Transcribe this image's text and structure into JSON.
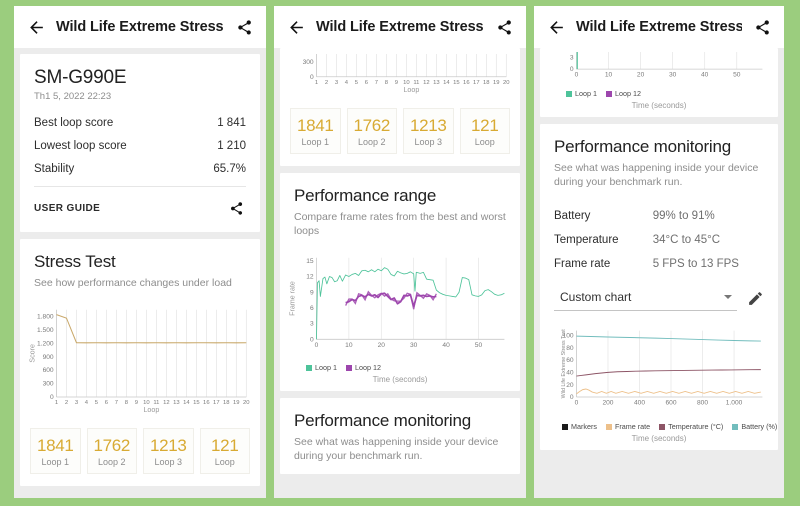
{
  "background_color": "#9bcd7e",
  "app": {
    "title": "Wild Life Extreme Stress...",
    "back_icon": "back-arrow-icon",
    "share_icon": "share-icon"
  },
  "summary": {
    "device": "SM-G990E",
    "timestamp": "Th1 5, 2022 22:23",
    "rows": [
      {
        "label": "Best loop score",
        "value": "1 841"
      },
      {
        "label": "Lowest loop score",
        "value": "1 210"
      },
      {
        "label": "Stability",
        "value": "65.7%"
      }
    ],
    "user_guide_label": "USER GUIDE"
  },
  "stress_test": {
    "title": "Stress Test",
    "subtitle": "See how performance changes under load"
  },
  "performance_range": {
    "title": "Performance range",
    "subtitle": "Compare frame rates from the best and worst loops"
  },
  "performance_monitoring": {
    "title": "Performance monitoring",
    "subtitle": "See what was happening inside your device during your benchmark run.",
    "rows": [
      {
        "label": "Battery",
        "value": "99% to 91%"
      },
      {
        "label": "Temperature",
        "value": "34°C to 45°C"
      },
      {
        "label": "Frame rate",
        "value": "5 FPS to 13 FPS"
      }
    ],
    "chart_select": {
      "value": "Custom chart",
      "edit_icon": "pencil-icon"
    }
  },
  "loop_cards": [
    {
      "score": "1841",
      "label": "Loop 1"
    },
    {
      "score": "1762",
      "label": "Loop 2"
    },
    {
      "score": "1213",
      "label": "Loop 3"
    },
    {
      "score": "121",
      "label": "Loop"
    }
  ],
  "chart_data": [
    {
      "id": "stress-test-chart",
      "type": "line",
      "title": "Stress Test",
      "xlabel": "Loop",
      "ylabel": "Score",
      "line_color": "#c9a86a",
      "grid": true,
      "xlim": [
        1,
        20
      ],
      "ylim": [
        0,
        1950
      ],
      "yticks": [
        0,
        300,
        600,
        900,
        1200,
        1500,
        1800
      ],
      "ytick_labels": [
        "0",
        "300",
        "600",
        "900",
        "1.200",
        "1.500",
        "1.800"
      ],
      "xticks": [
        1,
        2,
        3,
        4,
        5,
        6,
        7,
        8,
        9,
        10,
        11,
        12,
        13,
        14,
        15,
        16,
        17,
        18,
        19,
        20
      ],
      "x": [
        1,
        2,
        3,
        4,
        5,
        6,
        7,
        8,
        9,
        10,
        11,
        12,
        13,
        14,
        15,
        16,
        17,
        18,
        19,
        20
      ],
      "values": [
        1841,
        1762,
        1213,
        1210,
        1211,
        1210,
        1212,
        1210,
        1211,
        1210,
        1212,
        1210,
        1211,
        1210,
        1212,
        1211,
        1210,
        1211,
        1210,
        1212
      ]
    },
    {
      "id": "performance-range-chart",
      "type": "line",
      "title": "Performance range",
      "xlabel": "Time (seconds)",
      "ylabel": "Frame rate",
      "grid": true,
      "xlim": [
        0,
        58
      ],
      "ylim": [
        0,
        15.6
      ],
      "yticks": [
        0,
        3,
        6,
        9,
        12,
        15
      ],
      "xticks": [
        0,
        10,
        20,
        30,
        40,
        50
      ],
      "legend_position": "bottom-left",
      "series": [
        {
          "name": "Loop 1",
          "color": "#4ec39a",
          "x": [
            0,
            0.3,
            0.8,
            1.2,
            2,
            2.6,
            3.2,
            4,
            4.8,
            5.6,
            6.4,
            7.2,
            8,
            9,
            10,
            11,
            12,
            13,
            14,
            15,
            16,
            17,
            18,
            19,
            20,
            21,
            22,
            23,
            24,
            25,
            26,
            27,
            28,
            29,
            30,
            30.4,
            30.8,
            31.5,
            32,
            33,
            34,
            35,
            36,
            37,
            38,
            39,
            40,
            41,
            42,
            43,
            44,
            45,
            46,
            47,
            48,
            49,
            50,
            51,
            52,
            53,
            54,
            55,
            56,
            57,
            58
          ],
          "values": [
            0,
            10.8,
            11.2,
            8.2,
            11.6,
            11.9,
            10.6,
            12,
            11.8,
            11,
            11.2,
            12.2,
            11.1,
            12.3,
            12,
            12.4,
            12.6,
            12.2,
            13.1,
            13.2,
            12.9,
            13.3,
            12.9,
            13.4,
            13.1,
            13.7,
            13.4,
            12.4,
            12.1,
            13,
            12.7,
            12.5,
            12.6,
            12.9,
            12.5,
            9.2,
            12.8,
            12.7,
            12.6,
            12.8,
            11.5,
            11.4,
            11.3,
            9.4,
            8.9,
            8.6,
            8.4,
            8.3,
            8.2,
            8.1,
            9,
            11.8,
            11.7,
            11.4,
            8.5,
            8.3,
            8.2,
            8.5,
            9.3,
            9.5,
            9.1,
            8.6,
            8.4,
            8.5,
            8.8
          ]
        },
        {
          "name": "Loop 12",
          "color": "#9d46ad",
          "x": [
            9,
            10,
            11,
            12,
            13,
            14,
            15,
            16,
            17,
            18,
            19,
            20,
            21,
            22,
            23,
            24,
            25,
            26,
            27,
            28,
            29,
            30,
            31,
            32,
            33,
            34,
            35,
            36,
            37
          ],
          "values": [
            7.0,
            7.2,
            7.6,
            7.4,
            8.2,
            8.4,
            8.1,
            8.6,
            8.3,
            8.5,
            8.0,
            8.7,
            8.8,
            8.2,
            7.6,
            7.9,
            6.8,
            7.2,
            8.4,
            8.3,
            8.5,
            6.3,
            8.4,
            8.3,
            8.4,
            8.2,
            8.3,
            8.1,
            8.2
          ]
        }
      ]
    },
    {
      "id": "custom-monitoring-chart",
      "type": "line",
      "title": "Custom chart",
      "xlabel": "Time (seconds)",
      "ylabel": "Wild Life Extreme Stress Test",
      "grid": true,
      "xlim": [
        0,
        1180
      ],
      "ylim": [
        0,
        108
      ],
      "yticks": [
        0,
        20,
        40,
        60,
        80,
        100
      ],
      "xticks": [
        0,
        200,
        400,
        600,
        800,
        1000
      ],
      "xtick_labels": [
        "0",
        "200",
        "400",
        "600",
        "800",
        "1.000"
      ],
      "legend_position": "bottom-left",
      "series": [
        {
          "name": "Markers",
          "color": "#1a1a1a",
          "x": [],
          "values": []
        },
        {
          "name": "Frame rate",
          "color": "#edc08a",
          "x": [
            0,
            20,
            40,
            60,
            80,
            100,
            130,
            160,
            190,
            220,
            250,
            290,
            330,
            370,
            410,
            450,
            490,
            530,
            570,
            610,
            650,
            690,
            730,
            770,
            810,
            850,
            890,
            930,
            970,
            1010,
            1050,
            1090,
            1130,
            1170
          ],
          "values": [
            5,
            9,
            12,
            13,
            11,
            8,
            6,
            9,
            6,
            9,
            6,
            9,
            6,
            9,
            6,
            9,
            6,
            9,
            6,
            9,
            6,
            9,
            6,
            9,
            6,
            9,
            6,
            9,
            6,
            9,
            6,
            9,
            6,
            8
          ]
        },
        {
          "name": "Temperature (°C)",
          "color": "#8d5566",
          "x": [
            0,
            30,
            60,
            90,
            120,
            160,
            200,
            260,
            320,
            380,
            440,
            500,
            560,
            620,
            680,
            740,
            800,
            860,
            920,
            980,
            1040,
            1100,
            1170
          ],
          "values": [
            34,
            35,
            36,
            37,
            38,
            39,
            40,
            41,
            41.5,
            42,
            42.3,
            42.6,
            42.8,
            43,
            43.2,
            43.4,
            43.6,
            43.8,
            43.9,
            44,
            44.2,
            44.4,
            44.5
          ]
        },
        {
          "name": "Battery (%)",
          "color": "#72bdbd",
          "x": [
            0,
            60,
            120,
            200,
            300,
            400,
            500,
            600,
            700,
            800,
            900,
            1000,
            1100,
            1170
          ],
          "values": [
            99,
            98.6,
            98.2,
            97.6,
            97,
            96.4,
            95.8,
            95,
            94.2,
            93.4,
            92.6,
            91.9,
            91.3,
            91
          ]
        }
      ]
    }
  ]
}
